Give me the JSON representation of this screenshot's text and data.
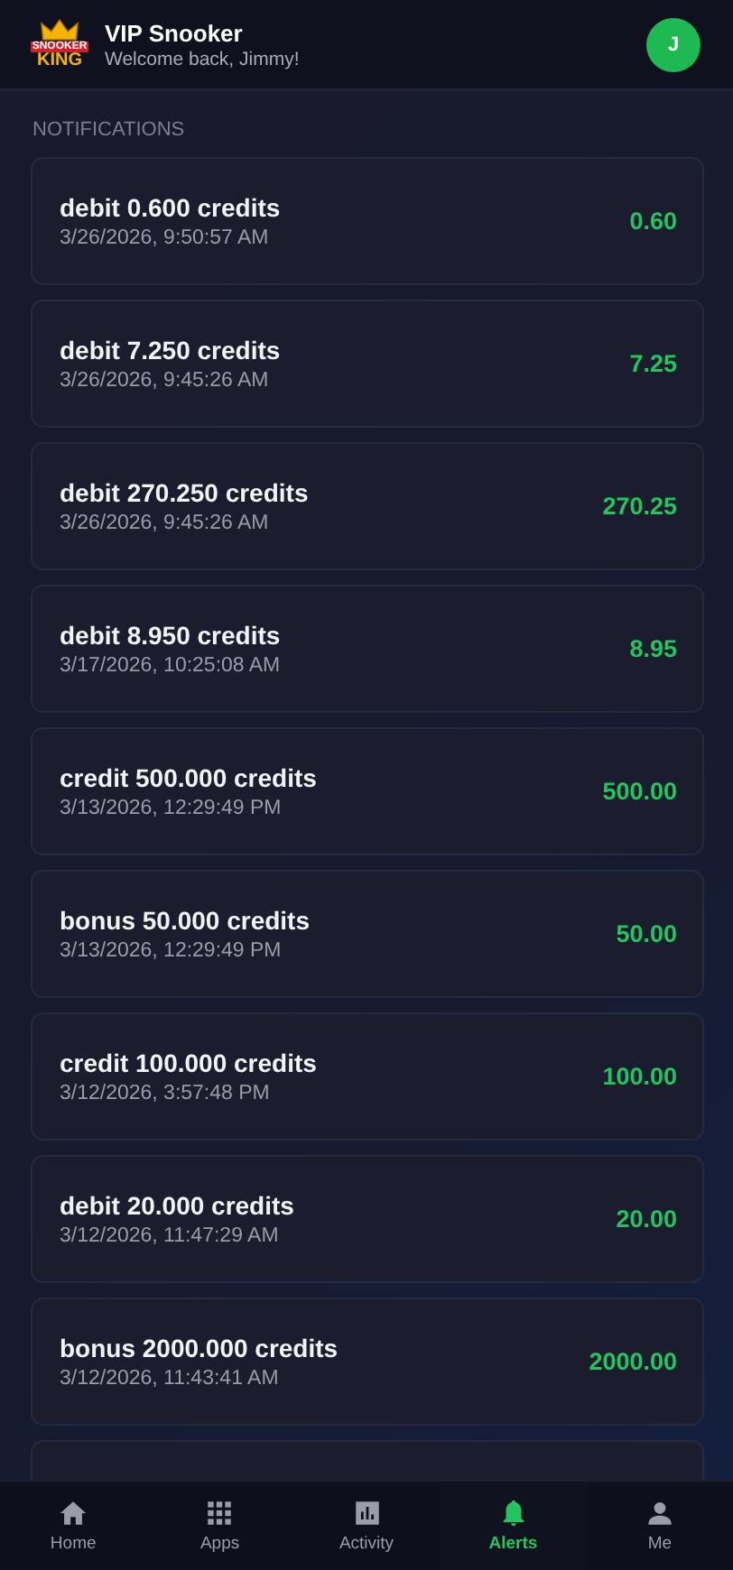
{
  "header": {
    "logo": {
      "top": "SNOOKER",
      "bottom": "KING"
    },
    "title": "VIP Snooker",
    "subtitle": "Welcome back, Jimmy!",
    "avatar": "J"
  },
  "section_title": "NOTIFICATIONS",
  "notifications": [
    {
      "title": "debit 0.600 credits",
      "time": "3/26/2026, 9:50:57 AM",
      "amount": "0.60"
    },
    {
      "title": "debit 7.250 credits",
      "time": "3/26/2026, 9:45:26 AM",
      "amount": "7.25"
    },
    {
      "title": "debit 270.250 credits",
      "time": "3/26/2026, 9:45:26 AM",
      "amount": "270.25"
    },
    {
      "title": "debit 8.950 credits",
      "time": "3/17/2026, 10:25:08 AM",
      "amount": "8.95"
    },
    {
      "title": "credit 500.000 credits",
      "time": "3/13/2026, 12:29:49 PM",
      "amount": "500.00"
    },
    {
      "title": "bonus 50.000 credits",
      "time": "3/13/2026, 12:29:49 PM",
      "amount": "50.00"
    },
    {
      "title": "credit 100.000 credits",
      "time": "3/12/2026, 3:57:48 PM",
      "amount": "100.00"
    },
    {
      "title": "debit 20.000 credits",
      "time": "3/12/2026, 11:47:29 AM",
      "amount": "20.00"
    },
    {
      "title": "bonus 2000.000 credits",
      "time": "3/12/2026, 11:43:41 AM",
      "amount": "2000.00"
    }
  ],
  "nav": [
    {
      "kind": "home",
      "label": "Home",
      "selected": false
    },
    {
      "kind": "apps",
      "label": "Apps",
      "selected": false
    },
    {
      "kind": "activity",
      "label": "Activity",
      "selected": false
    },
    {
      "kind": "alerts",
      "label": "Alerts",
      "selected": true
    },
    {
      "kind": "me",
      "label": "Me",
      "selected": false
    }
  ]
}
